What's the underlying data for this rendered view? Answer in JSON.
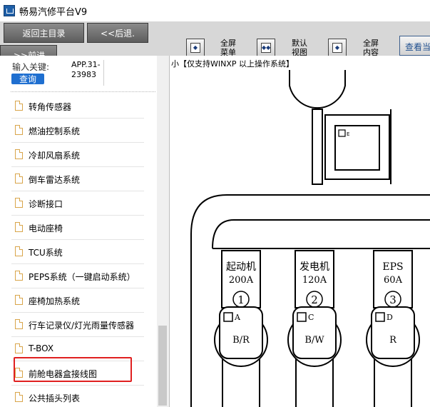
{
  "window": {
    "title": "畅易汽修平台V9"
  },
  "toolbar": {
    "home_label": "返回主目录",
    "back_label": "<<后退.",
    "forward_label": ">>前进",
    "tool1_label": "全屏\n菜单",
    "tool2_label": "默认\n视图",
    "tool3_label": "全屏\n内容",
    "view_label": "查看当"
  },
  "search": {
    "keyword_label": "输入关键:",
    "button_label": "查询",
    "value": "APP.31-23983"
  },
  "tree": {
    "items": [
      {
        "label": "转角传感器"
      },
      {
        "label": "燃油控制系统"
      },
      {
        "label": "冷却风扇系统"
      },
      {
        "label": "倒车雷达系统"
      },
      {
        "label": "诊断接口"
      },
      {
        "label": "电动座椅"
      },
      {
        "label": "TCU系统"
      },
      {
        "label": "PEPS系统（一键启动系统）"
      },
      {
        "label": "座椅加热系统"
      },
      {
        "label": "行车记录仪/灯光雨量传感器"
      },
      {
        "label": "T-BOX"
      },
      {
        "label": "前舱电器盒接线图"
      },
      {
        "label": "公共插头列表"
      }
    ],
    "highlighted_index": 11
  },
  "content": {
    "notice": "小【仅支持WINXP 以上操作系统】"
  },
  "diagram": {
    "top_connector_letter": "E",
    "fuses": [
      {
        "name": "起动机",
        "rating": "200A",
        "number": "1",
        "letter": "A",
        "wire": "B/R"
      },
      {
        "name": "发电机",
        "rating": "120A",
        "number": "2",
        "letter": "C",
        "wire": "B/W"
      },
      {
        "name": "EPS",
        "rating": "60A",
        "number": "3",
        "letter": "D",
        "wire": "R"
      }
    ]
  }
}
